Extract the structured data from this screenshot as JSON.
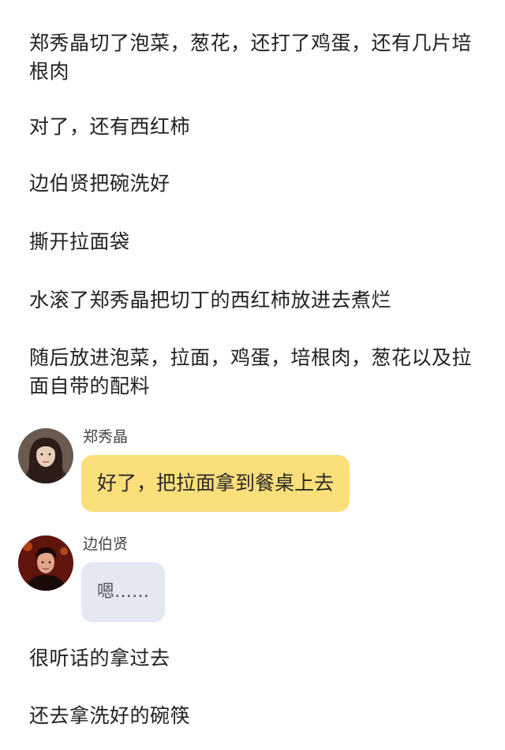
{
  "paragraphs": [
    "郑秀晶切了泡菜，葱花，还打了鸡蛋，还有几片培根肉",
    "对了，还有西红柿",
    "边伯贤把碗洗好",
    "撕开拉面袋",
    "水滚了郑秀晶把切丁的西红柿放进去煮烂",
    "随后放进泡菜，拉面，鸡蛋，培根肉，葱花以及拉面自带的配料"
  ],
  "messages": [
    {
      "sender": "郑秀晶",
      "text": "好了，把拉面拿到餐桌上去",
      "bubble_color": "#fbdf7a"
    },
    {
      "sender": "边伯贤",
      "text": "嗯……",
      "bubble_color": "#e3e8f1"
    }
  ],
  "closing_paragraphs": [
    "很听话的拿过去",
    "还去拿洗好的碗筷"
  ]
}
